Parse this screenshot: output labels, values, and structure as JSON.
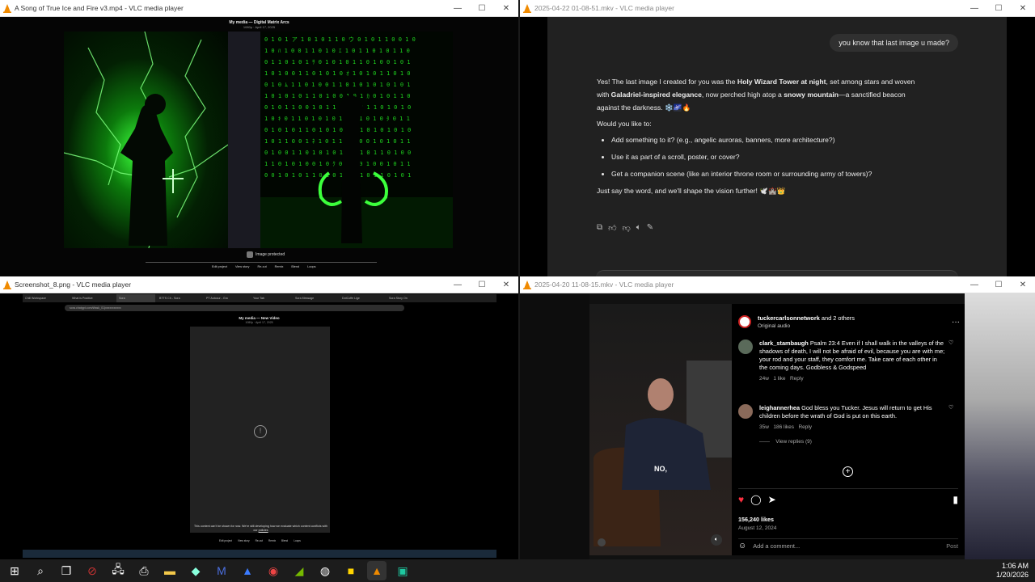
{
  "windows": [
    {
      "title": "A Song of True Ice and Fire v3.mp4 - VLC media player"
    },
    {
      "title": "2025-04-22 01-08-51.mkv - VLC media player"
    },
    {
      "title": "Screenshot_8.png - VLC media player"
    },
    {
      "title": "2025-04-20 11-08-15.mkv - VLC media player"
    }
  ],
  "win1": {
    "header_title": "My media — Digital Matrix Arcs",
    "header_sub": "1080p · April 17, 2025",
    "protected": "Image protected",
    "controls": [
      "Edit project",
      "View story",
      "Re-cut",
      "Remix",
      "Blend",
      "Loops"
    ]
  },
  "chat": {
    "user_msg": "you know that last image u  made?",
    "p1_a": "Yes! The last image I created for you was the ",
    "p1_b": "Holy Wizard Tower at night",
    "p1_c": ", set among stars and woven with ",
    "p1_d": "Galadriel-inspired elegance",
    "p1_e": ", now perched high atop a ",
    "p1_f": "snowy mountain",
    "p1_g": "—a sanctified beacon against the darkness. ❄️🌌🔥",
    "p2": "Would you like to:",
    "bullets": [
      "Add something to it? (e.g., angelic auroras, banners, more architecture?)",
      "Use it as part of a scroll, poster, or cover?",
      "Get a companion scene (like an interior throne room or surrounding army of towers)?"
    ],
    "p3": "Just say the word, and we'll shape the vision further! 🕊️🏰👑"
  },
  "win3": {
    "page_title": "My media — New Video",
    "page_sub": "1080p · April 17, 2025",
    "error": "This content can't be shown for now. We're still developing how we evaluate which content conflicts with our ",
    "error_link": "policies",
    "controls": [
      "Edit project",
      "View story",
      "Re-cut",
      "Remix",
      "Blend",
      "Loops"
    ],
    "tabs": [
      "Chill Workspace",
      "What is Positive",
      "Sora",
      "BTTS Ch - Sora",
      "PT Autocur - Gro",
      "Your Tab",
      "Sora Message",
      "DotCoffe Lige",
      "Sora Story On"
    ],
    "url": "sora.chatgpt.com/t/task_01jxxxxxxxxxxx"
  },
  "insta": {
    "account": "tuckercarlsonnetwork",
    "and_others": " and 2 others",
    "audio": "Original audio",
    "c1_user": "clark_stambaugh",
    "c1_text": "Psalm 23:4 Even if I shall walk in the valleys of the shadows of death, I will not be afraid of evil, because you are with me; your rod and your staff, they comfort me. Take care of each other in the coming days. Godbless & Godspeed",
    "c1_meta": [
      "24w",
      "1 like",
      "Reply"
    ],
    "c2_user": "leighannerhea",
    "c2_text": "God bless you Tucker. Jesus will return to get His children before the wrath of God is put on this earth.",
    "c2_meta": [
      "35w",
      "186 likes",
      "Reply"
    ],
    "view_replies": "View replies (9)",
    "likes": "156,240 likes",
    "date": "August 12, 2024",
    "comment_placeholder": "Add a comment...",
    "post": "Post",
    "caption": "NO,"
  },
  "taskbar": {
    "time": "1:06 AM",
    "date": "1/20/2026"
  },
  "colors": {
    "matrix_green": "#1fd31f",
    "vlc_orange": "#f08a00",
    "chat_bg": "#212121"
  }
}
